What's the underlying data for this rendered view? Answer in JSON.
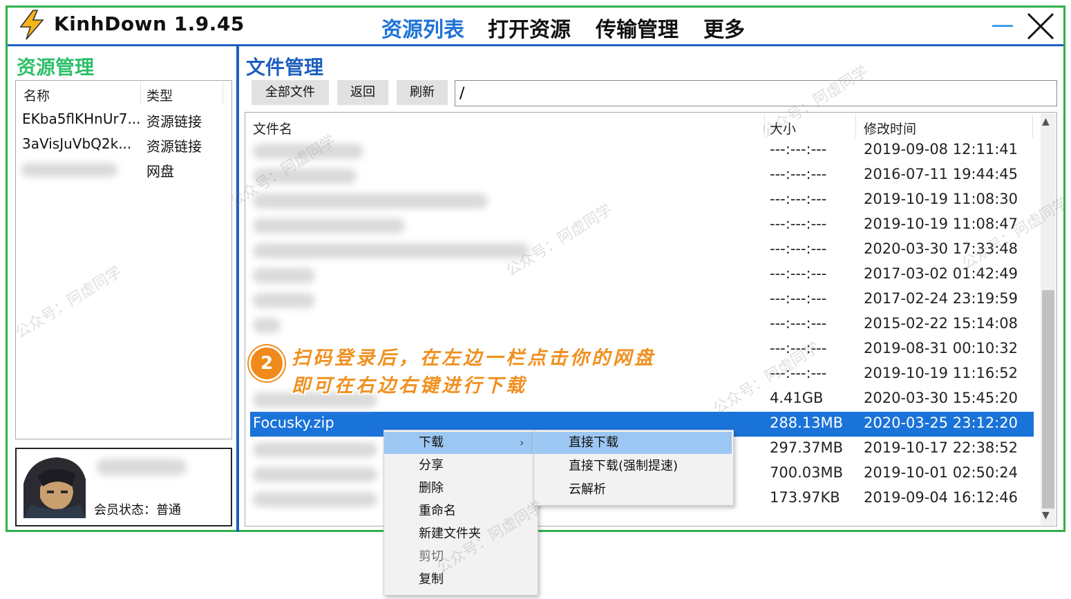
{
  "app": {
    "title": "KinhDown 1.9.45"
  },
  "nav": {
    "tabs": [
      "资源列表",
      "打开资源",
      "传输管理",
      "更多"
    ],
    "active": "资源列表",
    "accent_color": "#1e73d6"
  },
  "left_panel": {
    "heading": "资源管理",
    "heading_color": "#2fc06a",
    "columns": [
      "名称",
      "类型"
    ],
    "rows": [
      {
        "name": "EKba5flKHnUr7...",
        "type": "资源链接"
      },
      {
        "name": "3aVisJuVbQ2k...",
        "type": "资源链接"
      },
      {
        "name": "",
        "type": "网盘"
      }
    ],
    "member_status": "会员状态：普通"
  },
  "right_panel": {
    "heading": "文件管理",
    "heading_color": "#1e5fbf",
    "buttons": {
      "all_files": "全部文件",
      "back": "返回",
      "refresh": "刷新"
    },
    "path": "/",
    "columns": [
      "文件名",
      "大小",
      "修改时间"
    ],
    "rows": [
      {
        "name": "",
        "size": "---:---:---",
        "time": "2019-09-08 12:11:41"
      },
      {
        "name": "",
        "size": "---:---:---",
        "time": "2016-07-11 19:44:45"
      },
      {
        "name": "",
        "size": "---:---:---",
        "time": "2019-10-19 11:08:30"
      },
      {
        "name": "",
        "size": "---:---:---",
        "time": "2019-10-19 11:08:47"
      },
      {
        "name": "",
        "size": "---:---:---",
        "time": "2020-03-30 17:33:48"
      },
      {
        "name": "",
        "size": "---:---:---",
        "time": "2017-03-02 01:42:49"
      },
      {
        "name": "",
        "size": "---:---:---",
        "time": "2017-02-24 23:19:59"
      },
      {
        "name": "",
        "size": "---:---:---",
        "time": "2015-02-22 15:14:08"
      },
      {
        "name": "",
        "size": "---:---:---",
        "time": "2019-08-31 00:10:32"
      },
      {
        "name": "",
        "size": "---:---:---",
        "time": "2019-10-19 11:16:52"
      },
      {
        "name": "",
        "size": "4.41GB",
        "time": "2020-03-30 15:45:20"
      },
      {
        "name": "Focusky.zip",
        "size": "288.13MB",
        "time": "2020-03-25 23:12:20",
        "selected": true
      },
      {
        "name": "",
        "size": "297.37MB",
        "time": "2019-10-17 22:38:52"
      },
      {
        "name": "",
        "size": "700.03MB",
        "time": "2019-10-01 02:50:24"
      },
      {
        "name": "",
        "size": "173.97KB",
        "time": "2019-09-04 16:12:46"
      }
    ],
    "selected_color": "#1a73d8"
  },
  "context_menu": {
    "items": [
      "下载",
      "分享",
      "删除",
      "重命名",
      "新建文件夹",
      "剪切",
      "复制"
    ],
    "submenu_arrow": "›",
    "submenu": [
      "直接下载",
      "直接下载(强制提速)",
      "云解析"
    ]
  },
  "annotation": {
    "step": "2",
    "line1": "扫码登录后，在左边一栏点击你的网盘",
    "line2": "即可在右边右键进行下载",
    "color": "#f09020"
  },
  "watermark": "公众号：阿虚同学"
}
